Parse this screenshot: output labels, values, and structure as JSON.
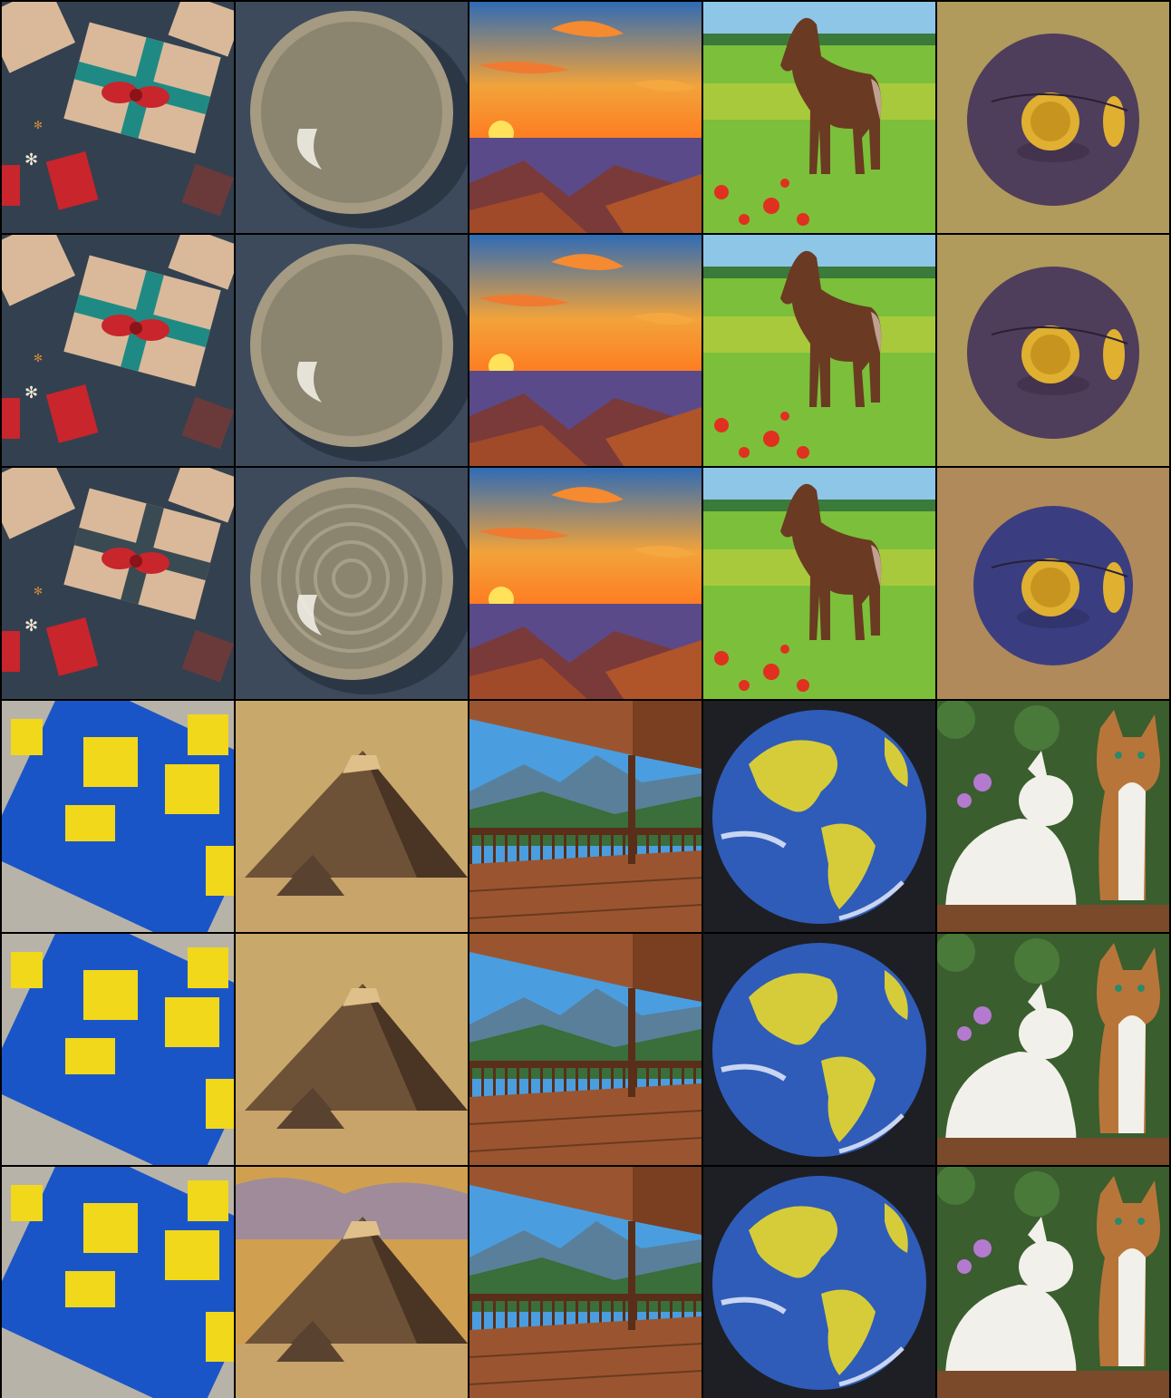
{
  "grid": {
    "columns": 5,
    "rows": 6,
    "subjects": [
      "gift-boxes",
      "ceramic-bowl",
      "canyon-sunset",
      "horse-in-meadow",
      "purple-orb",
      "blue-storage-bin",
      "pyramid",
      "mountain-deck",
      "earth-globe",
      "two-cats"
    ],
    "background": "#000000"
  },
  "palette": {
    "gift_bg": "#33404f",
    "gift_paper": "#d9b99a",
    "gift_red": "#c8252c",
    "gift_teal": "#1f8a84",
    "bowl_bg": "#3c4a5c",
    "bowl_rim": "#a59a82",
    "bowl_inner": "#8b8570",
    "sky_top": "#2f6bb5",
    "sky_orange": "#f2a33a",
    "sun": "#ffe25a",
    "canyon": "#7a3a3a",
    "meadow_sky": "#8ec6e8",
    "meadow_grass": "#7cbf3a",
    "horse": "#6a3a22",
    "orb_bg": "#b09a5c",
    "orb_body": "#4f3d5c",
    "orb_gold": "#e0b030",
    "bin_bg": "#b8b3a8",
    "bin_blue": "#1a55c8",
    "bin_yellow": "#f2d81a",
    "pyr_bg": "#c9a86b",
    "pyr_body": "#6e5238",
    "deck_wood": "#9a5530",
    "deck_sky": "#4a9ee0",
    "mountain": "#5a7f9a",
    "forest": "#3a6e3a",
    "earth_bg": "#1d1f24",
    "ocean": "#2f5cb8",
    "land": "#d6cc3a",
    "cat_bg": "#3a5e2e",
    "cat_white": "#f2f0ea",
    "cat_tabby": "#b8753a",
    "flower": "#b47ad0"
  },
  "tiles": [
    {
      "subject": "gift-boxes",
      "variant": 1
    },
    {
      "subject": "ceramic-bowl",
      "variant": 1
    },
    {
      "subject": "canyon-sunset",
      "variant": 1
    },
    {
      "subject": "horse-in-meadow",
      "variant": 1
    },
    {
      "subject": "purple-orb",
      "variant": 1
    },
    {
      "subject": "gift-boxes",
      "variant": 2
    },
    {
      "subject": "ceramic-bowl",
      "variant": 2
    },
    {
      "subject": "canyon-sunset",
      "variant": 2
    },
    {
      "subject": "horse-in-meadow",
      "variant": 2
    },
    {
      "subject": "purple-orb",
      "variant": 2
    },
    {
      "subject": "gift-boxes",
      "variant": 3
    },
    {
      "subject": "ceramic-bowl",
      "variant": 3
    },
    {
      "subject": "canyon-sunset",
      "variant": 3
    },
    {
      "subject": "horse-in-meadow",
      "variant": 3
    },
    {
      "subject": "purple-orb",
      "variant": 3
    },
    {
      "subject": "blue-storage-bin",
      "variant": 1
    },
    {
      "subject": "pyramid",
      "variant": 1
    },
    {
      "subject": "mountain-deck",
      "variant": 1
    },
    {
      "subject": "earth-globe",
      "variant": 1
    },
    {
      "subject": "two-cats",
      "variant": 1
    },
    {
      "subject": "blue-storage-bin",
      "variant": 2
    },
    {
      "subject": "pyramid",
      "variant": 2
    },
    {
      "subject": "mountain-deck",
      "variant": 2
    },
    {
      "subject": "earth-globe",
      "variant": 2
    },
    {
      "subject": "two-cats",
      "variant": 2
    },
    {
      "subject": "blue-storage-bin",
      "variant": 3
    },
    {
      "subject": "pyramid",
      "variant": 3
    },
    {
      "subject": "mountain-deck",
      "variant": 3
    },
    {
      "subject": "earth-globe",
      "variant": 3
    },
    {
      "subject": "two-cats",
      "variant": 3
    }
  ]
}
